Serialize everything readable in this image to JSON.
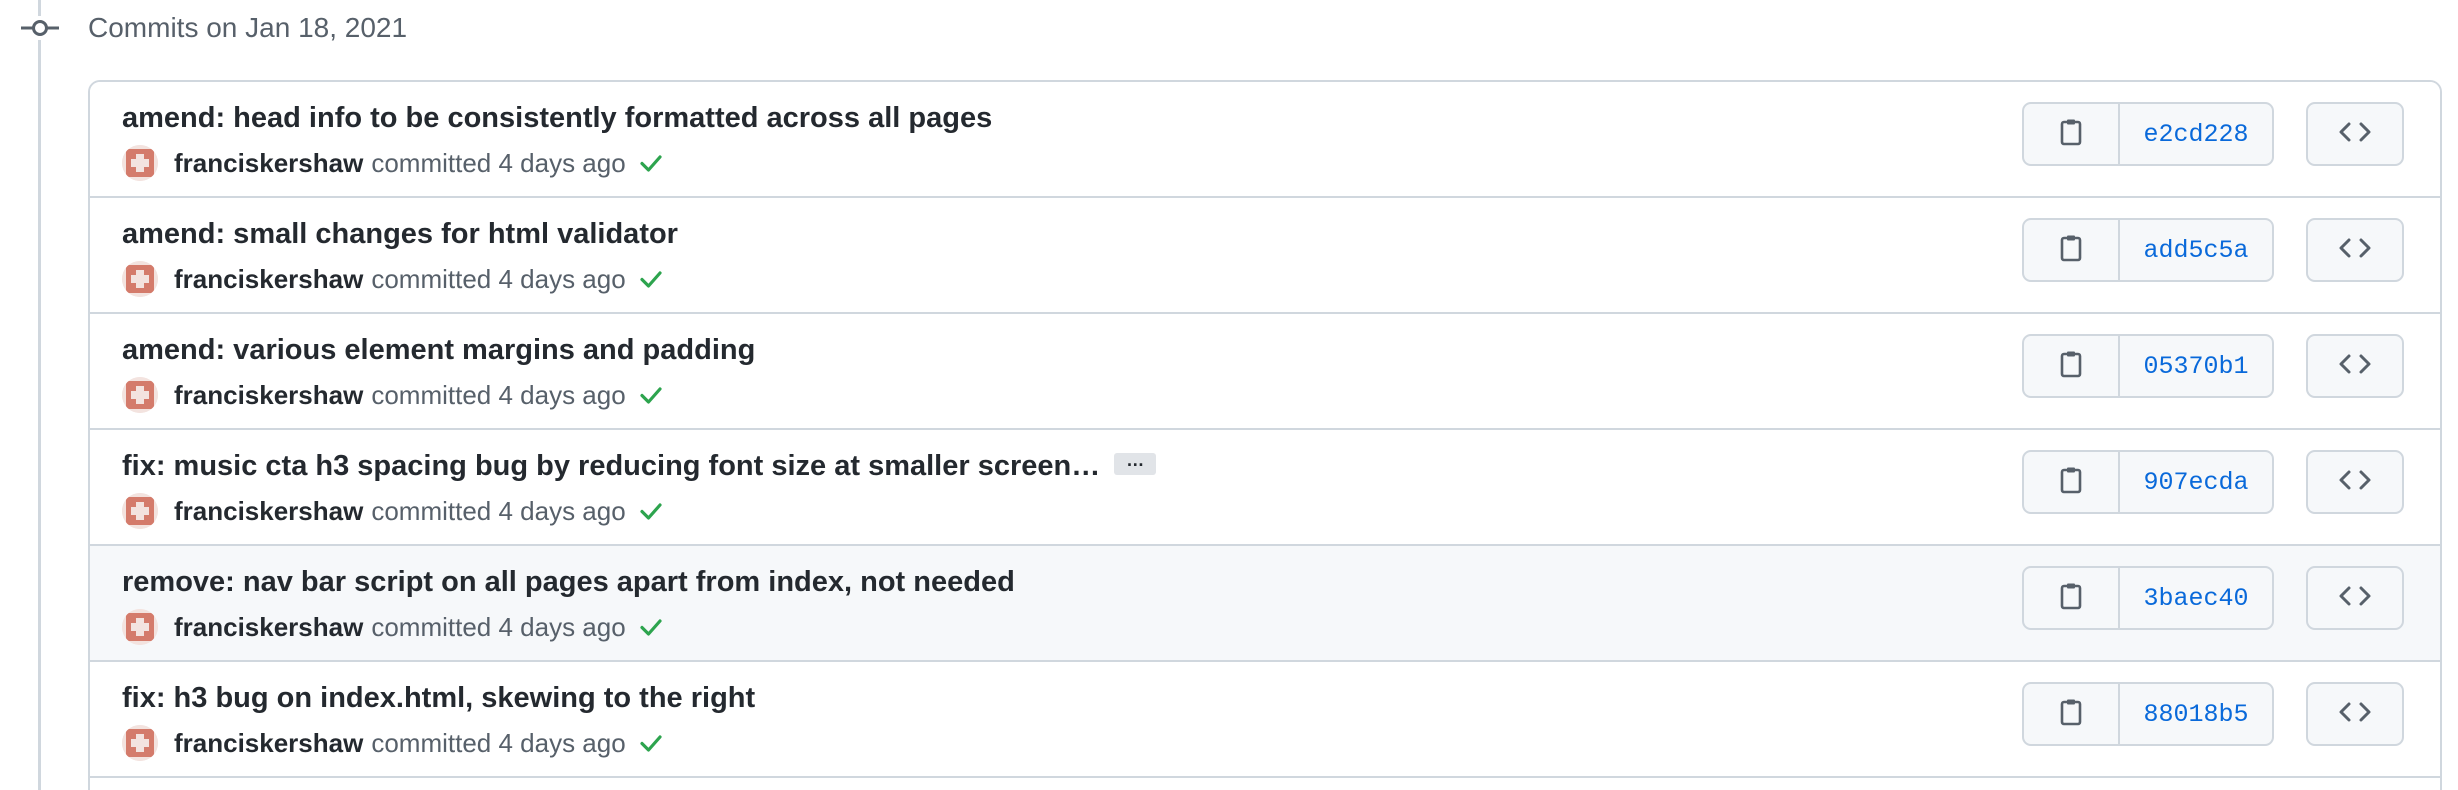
{
  "header": {
    "group_title": "Commits on Jan 18, 2021"
  },
  "commits": [
    {
      "title": "amend: head info to be consistently formatted across all pages",
      "author": "franciskershaw",
      "committed": "committed 4 days ago",
      "sha": "e2cd228",
      "truncated": false,
      "highlighted": false
    },
    {
      "title": "amend: small changes for html validator",
      "author": "franciskershaw",
      "committed": "committed 4 days ago",
      "sha": "add5c5a",
      "truncated": false,
      "highlighted": false
    },
    {
      "title": "amend: various element margins and padding",
      "author": "franciskershaw",
      "committed": "committed 4 days ago",
      "sha": "05370b1",
      "truncated": false,
      "highlighted": false
    },
    {
      "title": "fix: music cta h3 spacing bug by reducing font size at smaller screen…",
      "author": "franciskershaw",
      "committed": "committed 4 days ago",
      "sha": "907ecda",
      "truncated": true,
      "highlighted": false
    },
    {
      "title": "remove: nav bar script on all pages apart from index, not needed",
      "author": "franciskershaw",
      "committed": "committed 4 days ago",
      "sha": "3baec40",
      "truncated": false,
      "highlighted": true
    },
    {
      "title": "fix: h3 bug on index.html, skewing to the right",
      "author": "franciskershaw",
      "committed": "committed 4 days ago",
      "sha": "88018b5",
      "truncated": false,
      "highlighted": false
    }
  ],
  "labels": {
    "expand": "…"
  },
  "icons": {
    "timeline_node": "git-commit-icon",
    "avatar": "avatar-identicon",
    "status": "check-icon",
    "copy": "clipboard-icon",
    "browse": "code-icon"
  },
  "colors": {
    "status_success": "#2da44e",
    "sha_link": "#0969da",
    "avatar": "#d47b6b",
    "highlight_row": "#f6f8fa"
  }
}
